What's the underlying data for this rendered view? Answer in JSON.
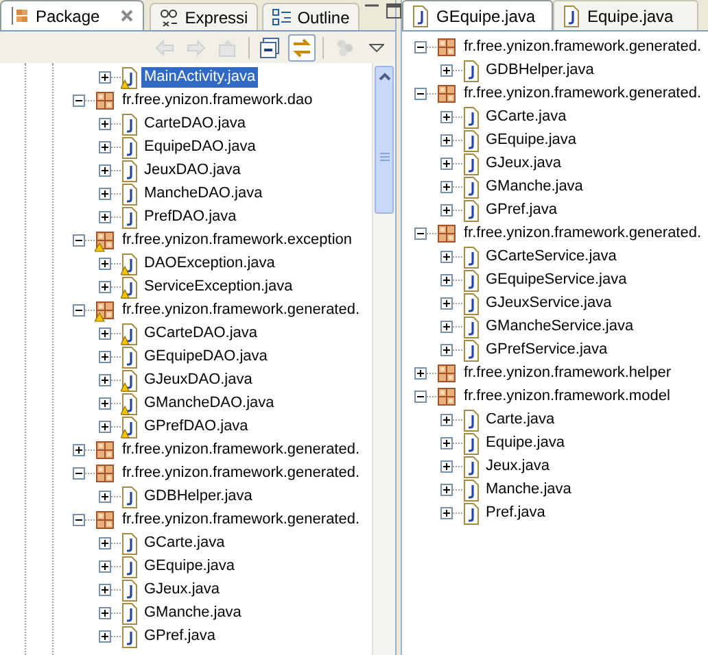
{
  "left_view": {
    "tabs": [
      {
        "label": "Package",
        "kind": "package",
        "selected": true,
        "closable": true
      },
      {
        "label": "Expressi",
        "kind": "expressions",
        "selected": false,
        "closable": false
      },
      {
        "label": "Outline",
        "kind": "outline",
        "selected": false,
        "closable": false
      }
    ],
    "toolbar": [
      {
        "kind": "back",
        "disabled": true
      },
      {
        "kind": "forward",
        "disabled": true
      },
      {
        "kind": "up",
        "disabled": true
      },
      {
        "kind": "collapse",
        "disabled": false,
        "pressed": false
      },
      {
        "kind": "link",
        "disabled": false,
        "pressed": true
      },
      {
        "kind": "filters",
        "disabled": true
      },
      {
        "kind": "menu",
        "disabled": false
      }
    ],
    "tree": [
      {
        "kind": "file",
        "label": "MainActivity.java",
        "warning": true,
        "selected": true,
        "expanded": false
      },
      {
        "kind": "package",
        "label": "fr.free.ynizon.framework.dao",
        "warning": false,
        "selected": false,
        "expanded": true,
        "children": [
          {
            "kind": "file",
            "label": "CarteDAO.java",
            "warning": false,
            "selected": false,
            "expanded": false
          },
          {
            "kind": "file",
            "label": "EquipeDAO.java",
            "warning": false,
            "selected": false,
            "expanded": false
          },
          {
            "kind": "file",
            "label": "JeuxDAO.java",
            "warning": false,
            "selected": false,
            "expanded": false
          },
          {
            "kind": "file",
            "label": "MancheDAO.java",
            "warning": false,
            "selected": false,
            "expanded": false
          },
          {
            "kind": "file",
            "label": "PrefDAO.java",
            "warning": false,
            "selected": false,
            "expanded": false
          }
        ]
      },
      {
        "kind": "package",
        "label": "fr.free.ynizon.framework.exception",
        "warning": true,
        "selected": false,
        "expanded": true,
        "children": [
          {
            "kind": "file",
            "label": "DAOException.java",
            "warning": true,
            "selected": false,
            "expanded": false
          },
          {
            "kind": "file",
            "label": "ServiceException.java",
            "warning": true,
            "selected": false,
            "expanded": false
          }
        ]
      },
      {
        "kind": "package",
        "label": "fr.free.ynizon.framework.generated.",
        "warning": true,
        "selected": false,
        "expanded": true,
        "children": [
          {
            "kind": "file",
            "label": "GCarteDAO.java",
            "warning": true,
            "selected": false,
            "expanded": false
          },
          {
            "kind": "file",
            "label": "GEquipeDAO.java",
            "warning": false,
            "selected": false,
            "expanded": false
          },
          {
            "kind": "file",
            "label": "GJeuxDAO.java",
            "warning": true,
            "selected": false,
            "expanded": false
          },
          {
            "kind": "file",
            "label": "GMancheDAO.java",
            "warning": true,
            "selected": false,
            "expanded": false
          },
          {
            "kind": "file",
            "label": "GPrefDAO.java",
            "warning": true,
            "selected": false,
            "expanded": false
          }
        ]
      },
      {
        "kind": "package",
        "label": "fr.free.ynizon.framework.generated.",
        "warning": false,
        "selected": false,
        "expanded": false
      },
      {
        "kind": "package",
        "label": "fr.free.ynizon.framework.generated.",
        "warning": false,
        "selected": false,
        "expanded": true,
        "children": [
          {
            "kind": "file",
            "label": "GDBHelper.java",
            "warning": false,
            "selected": false,
            "expanded": false
          }
        ]
      },
      {
        "kind": "package",
        "label": "fr.free.ynizon.framework.generated.",
        "warning": false,
        "selected": false,
        "expanded": true,
        "children": [
          {
            "kind": "file",
            "label": "GCarte.java",
            "warning": false,
            "selected": false,
            "expanded": false
          },
          {
            "kind": "file",
            "label": "GEquipe.java",
            "warning": false,
            "selected": false,
            "expanded": false
          },
          {
            "kind": "file",
            "label": "GJeux.java",
            "warning": false,
            "selected": false,
            "expanded": false
          },
          {
            "kind": "file",
            "label": "GManche.java",
            "warning": false,
            "selected": false,
            "expanded": false
          },
          {
            "kind": "file",
            "label": "GPref.java",
            "warning": false,
            "selected": false,
            "expanded": false
          }
        ]
      }
    ]
  },
  "right_view": {
    "tabs": [
      {
        "label": "GEquipe.java",
        "selected": true
      },
      {
        "label": "Equipe.java",
        "selected": false
      }
    ],
    "tree": [
      {
        "kind": "package",
        "label": "fr.free.ynizon.framework.generated.",
        "warning": false,
        "selected": false,
        "expanded": true,
        "children": [
          {
            "kind": "file",
            "label": "GDBHelper.java",
            "warning": false,
            "selected": false,
            "expanded": false
          }
        ]
      },
      {
        "kind": "package",
        "label": "fr.free.ynizon.framework.generated.",
        "warning": false,
        "selected": false,
        "expanded": true,
        "children": [
          {
            "kind": "file",
            "label": "GCarte.java",
            "warning": false,
            "selected": false,
            "expanded": false
          },
          {
            "kind": "file",
            "label": "GEquipe.java",
            "warning": false,
            "selected": false,
            "expanded": false
          },
          {
            "kind": "file",
            "label": "GJeux.java",
            "warning": false,
            "selected": false,
            "expanded": false
          },
          {
            "kind": "file",
            "label": "GManche.java",
            "warning": false,
            "selected": false,
            "expanded": false
          },
          {
            "kind": "file",
            "label": "GPref.java",
            "warning": false,
            "selected": false,
            "expanded": false
          }
        ]
      },
      {
        "kind": "package",
        "label": "fr.free.ynizon.framework.generated.",
        "warning": false,
        "selected": false,
        "expanded": true,
        "children": [
          {
            "kind": "file",
            "label": "GCarteService.java",
            "warning": false,
            "selected": false,
            "expanded": false
          },
          {
            "kind": "file",
            "label": "GEquipeService.java",
            "warning": false,
            "selected": false,
            "expanded": false
          },
          {
            "kind": "file",
            "label": "GJeuxService.java",
            "warning": false,
            "selected": false,
            "expanded": false
          },
          {
            "kind": "file",
            "label": "GMancheService.java",
            "warning": false,
            "selected": false,
            "expanded": false
          },
          {
            "kind": "file",
            "label": "GPrefService.java",
            "warning": false,
            "selected": false,
            "expanded": false
          }
        ]
      },
      {
        "kind": "package",
        "label": "fr.free.ynizon.framework.helper",
        "warning": false,
        "selected": false,
        "expanded": false
      },
      {
        "kind": "package",
        "label": "fr.free.ynizon.framework.model",
        "warning": false,
        "selected": false,
        "expanded": true,
        "children": [
          {
            "kind": "file",
            "label": "Carte.java",
            "warning": false,
            "selected": false,
            "expanded": false
          },
          {
            "kind": "file",
            "label": "Equipe.java",
            "warning": false,
            "selected": false,
            "expanded": false
          },
          {
            "kind": "file",
            "label": "Jeux.java",
            "warning": false,
            "selected": false,
            "expanded": false
          },
          {
            "kind": "file",
            "label": "Manche.java",
            "warning": false,
            "selected": false,
            "expanded": false
          },
          {
            "kind": "file",
            "label": "Pref.java",
            "warning": false,
            "selected": false,
            "expanded": false
          }
        ]
      }
    ]
  }
}
